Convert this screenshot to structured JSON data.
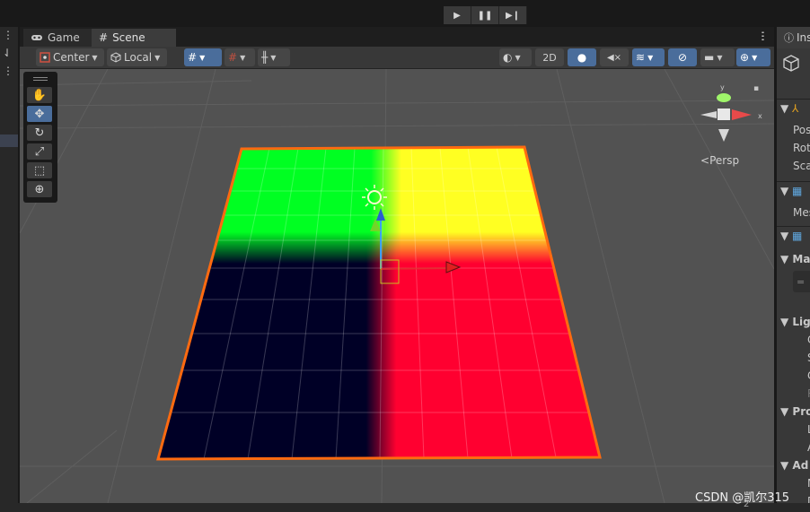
{
  "playbar": {
    "play_icon": "▶",
    "pause_icon": "❚❚",
    "step_icon": "▶❙"
  },
  "tabs": {
    "game_label": "Game",
    "scene_label": "Scene"
  },
  "toolbar": {
    "pivot_label": "Center",
    "space_label": "Local",
    "mode_2d_label": "2D"
  },
  "scene": {
    "projection_label": "Persp",
    "quadrant_colors": {
      "top_left": "#00ff22",
      "top_right": "#ffff22",
      "bottom_left": "#000026",
      "bottom_right": "#ff0030"
    },
    "outline_color": "#ff6a10"
  },
  "inspector": {
    "tab_label": "Ins",
    "rows": [
      "Pos",
      "Rot",
      "Sca",
      "Mes",
      "Ma",
      "Lig",
      "Pro",
      "Ad"
    ]
  },
  "bottom": {
    "counter": "2"
  },
  "watermark": "CSDN @凯尔315"
}
